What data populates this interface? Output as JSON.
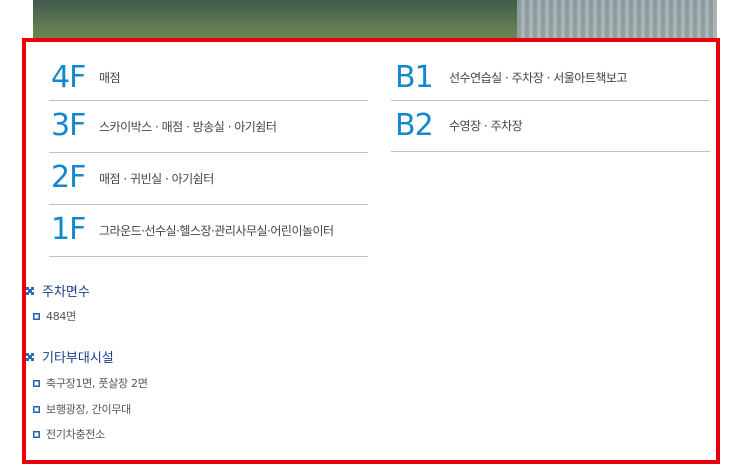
{
  "floors_left": [
    {
      "code": "4F",
      "desc": "매점"
    },
    {
      "code": "3F",
      "desc": "스카이박스 · 매점 · 방송실 · 아기쉼터"
    },
    {
      "code": "2F",
      "desc": "매점 · 귀빈실 · 아기쉼터"
    },
    {
      "code": "1F",
      "desc": "그라운드·선수실·헬스장·관리사무실·어린이놀이터"
    }
  ],
  "floors_right": [
    {
      "code": "B1",
      "desc": "선수연습실 · 주차장 · 서울아트책보고"
    },
    {
      "code": "B2",
      "desc": "수영장 · 주차장"
    }
  ],
  "parking": {
    "title": "주차면수",
    "items": [
      "484면"
    ]
  },
  "facilities": {
    "title": "기타부대시설",
    "items": [
      "축구장1면, 풋살장 2면",
      "보행광장, 간이무대",
      "전기차충전소"
    ]
  },
  "colors": {
    "frame": "#e8000b",
    "floor_code": "#1488cc",
    "section_title": "#1a3c8a"
  }
}
